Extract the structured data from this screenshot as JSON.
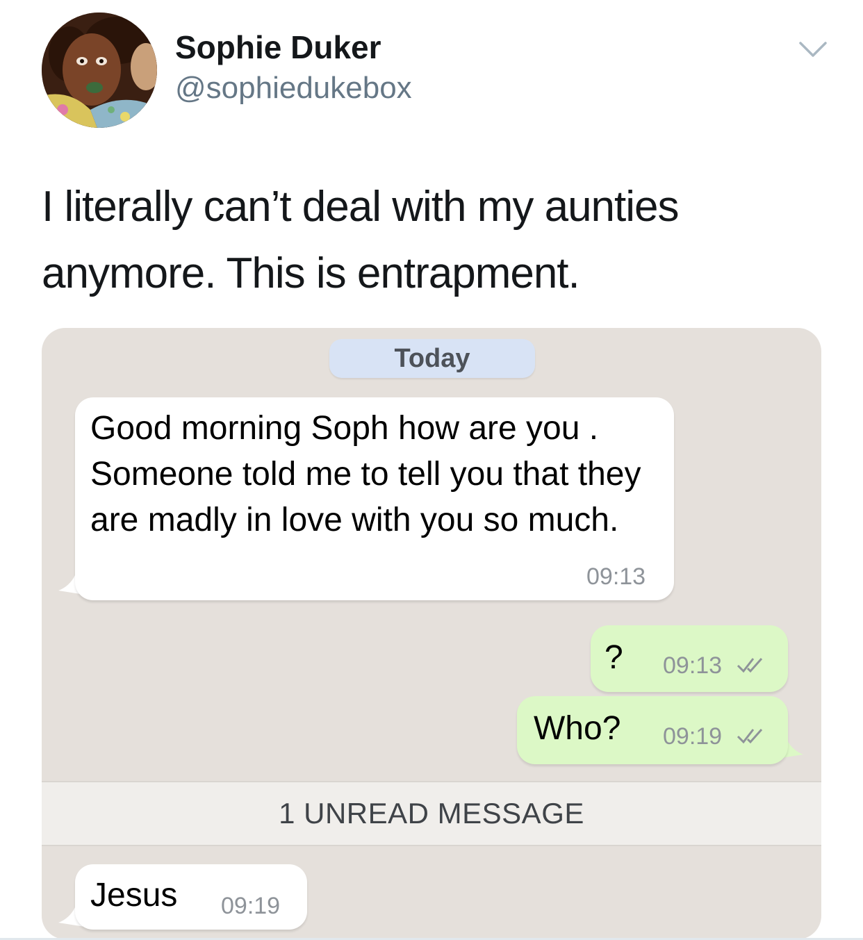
{
  "tweet": {
    "author_name": "Sophie Duker",
    "author_handle": "@sophiedukebox",
    "text": "I literally can’t deal with my aunties anymore. This is entrapment.",
    "menu_icon": "chevron-down-icon"
  },
  "chat": {
    "date_label": "Today",
    "unread_label": "1 UNREAD MESSAGE",
    "colors": {
      "background": "#e5e0db",
      "incoming_bubble": "#ffffff",
      "outgoing_bubble": "#dcf8c6",
      "date_pill": "#d8e3f5"
    },
    "messages": [
      {
        "direction": "incoming",
        "text": "Good morning Soph  how are you . Someone told me to tell you that they are madly in  love with you so much.",
        "time": "09:13"
      },
      {
        "direction": "outgoing",
        "text": "?",
        "time": "09:13",
        "status_icon": "double-check-icon"
      },
      {
        "direction": "outgoing",
        "text": "Who?",
        "time": "09:19",
        "status_icon": "double-check-icon"
      },
      {
        "direction": "incoming",
        "text": "Jesus",
        "time": "09:19"
      }
    ]
  }
}
